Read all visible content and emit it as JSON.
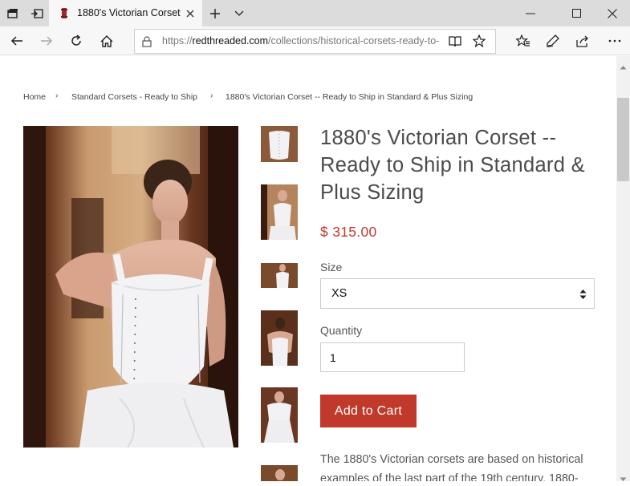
{
  "browser": {
    "tab_title": "1880's Victorian Corset",
    "url_scheme": "https://",
    "url_host": "redthreaded.com",
    "url_path": "/collections/historical-corsets-ready-to-"
  },
  "breadcrumb": {
    "home": "Home",
    "collection": "Standard Corsets - Ready to Ship",
    "current": "1880's Victorian Corset -- Ready to Ship in Standard & Plus Sizing",
    "separator": "›"
  },
  "product": {
    "title": "1880's Victorian Corset -- Ready to Ship in Standard & Plus Sizing",
    "price": "$ 315.00",
    "size_label": "Size",
    "size_value": "XS",
    "quantity_label": "Quantity",
    "quantity_value": "1",
    "add_to_cart": "Add to Cart",
    "description": "The 1880's Victorian corsets are based on historical examples of the last part of the 19th century. 1880-"
  },
  "colors": {
    "accent": "#c0392b",
    "text": "#4b4b4b"
  }
}
